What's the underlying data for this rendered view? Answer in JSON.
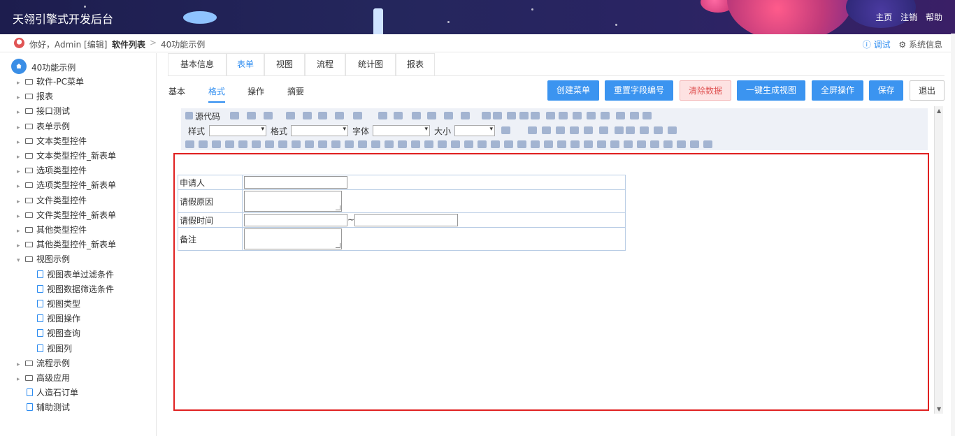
{
  "header": {
    "title": "天翎引擎式开发后台",
    "nav": [
      "主页",
      "注销",
      "帮助"
    ]
  },
  "crumb": {
    "greeting": "你好，Admin [编辑]",
    "item1": "软件列表",
    "separator": ">",
    "item2": "40功能示例",
    "debug": "ⓘ 调试",
    "sysinfo": "⚙ 系统信息"
  },
  "sidebar": {
    "root": "40功能示例",
    "items": [
      {
        "label": "软件-PC菜单",
        "type": "folder",
        "level": 1
      },
      {
        "label": "报表",
        "type": "folder",
        "level": 1
      },
      {
        "label": "接口测试",
        "type": "folder",
        "level": 1
      },
      {
        "label": "表单示例",
        "type": "folder",
        "level": 1
      },
      {
        "label": "文本类型控件",
        "type": "folder",
        "level": 1
      },
      {
        "label": "文本类型控件_新表单",
        "type": "folder",
        "level": 1
      },
      {
        "label": "选项类型控件",
        "type": "folder",
        "level": 1
      },
      {
        "label": "选项类型控件_新表单",
        "type": "folder",
        "level": 1
      },
      {
        "label": "文件类型控件",
        "type": "folder",
        "level": 1
      },
      {
        "label": "文件类型控件_新表单",
        "type": "folder",
        "level": 1
      },
      {
        "label": "其他类型控件",
        "type": "folder",
        "level": 1
      },
      {
        "label": "其他类型控件_新表单",
        "type": "folder",
        "level": 1
      },
      {
        "label": "视图示例",
        "type": "folder-open",
        "level": 1
      },
      {
        "label": "视图表单过滤条件",
        "type": "file",
        "level": 2
      },
      {
        "label": "视图数据筛选条件",
        "type": "file",
        "level": 2
      },
      {
        "label": "视图类型",
        "type": "file",
        "level": 2
      },
      {
        "label": "视图操作",
        "type": "file",
        "level": 2
      },
      {
        "label": "视图查询",
        "type": "file",
        "level": 2
      },
      {
        "label": "视图列",
        "type": "file",
        "level": 2
      },
      {
        "label": "流程示例",
        "type": "folder",
        "level": 1
      },
      {
        "label": "高级应用",
        "type": "folder",
        "level": 1
      },
      {
        "label": "人造石订单",
        "type": "file",
        "level": 1
      },
      {
        "label": "辅助测试",
        "type": "file",
        "level": 1
      }
    ]
  },
  "tabs": [
    "基本信息",
    "表单",
    "视图",
    "流程",
    "统计图",
    "报表"
  ],
  "active_tab": "表单",
  "subtabs": [
    "基本",
    "格式",
    "操作",
    "摘要"
  ],
  "active_subtab": "格式",
  "buttons": [
    "创建菜单",
    "重置字段编号",
    "清除数据",
    "一键生成视图",
    "全屏操作",
    "保存",
    "退出"
  ],
  "toolbar": {
    "source": "源代码",
    "style_label": "样式",
    "format_label": "格式",
    "font_label": "字体",
    "size_label": "大小"
  },
  "form": {
    "rows": [
      {
        "label": "申请人",
        "kind": "input"
      },
      {
        "label": "请假原因",
        "kind": "textarea"
      },
      {
        "label": "请假时间",
        "kind": "range",
        "sep": "~"
      },
      {
        "label": "备注",
        "kind": "textarea"
      }
    ]
  },
  "colors": {
    "accent": "#2d8cf0",
    "button": "#3b94f0",
    "danger": "#e05555",
    "highlight_border": "#e02020"
  }
}
